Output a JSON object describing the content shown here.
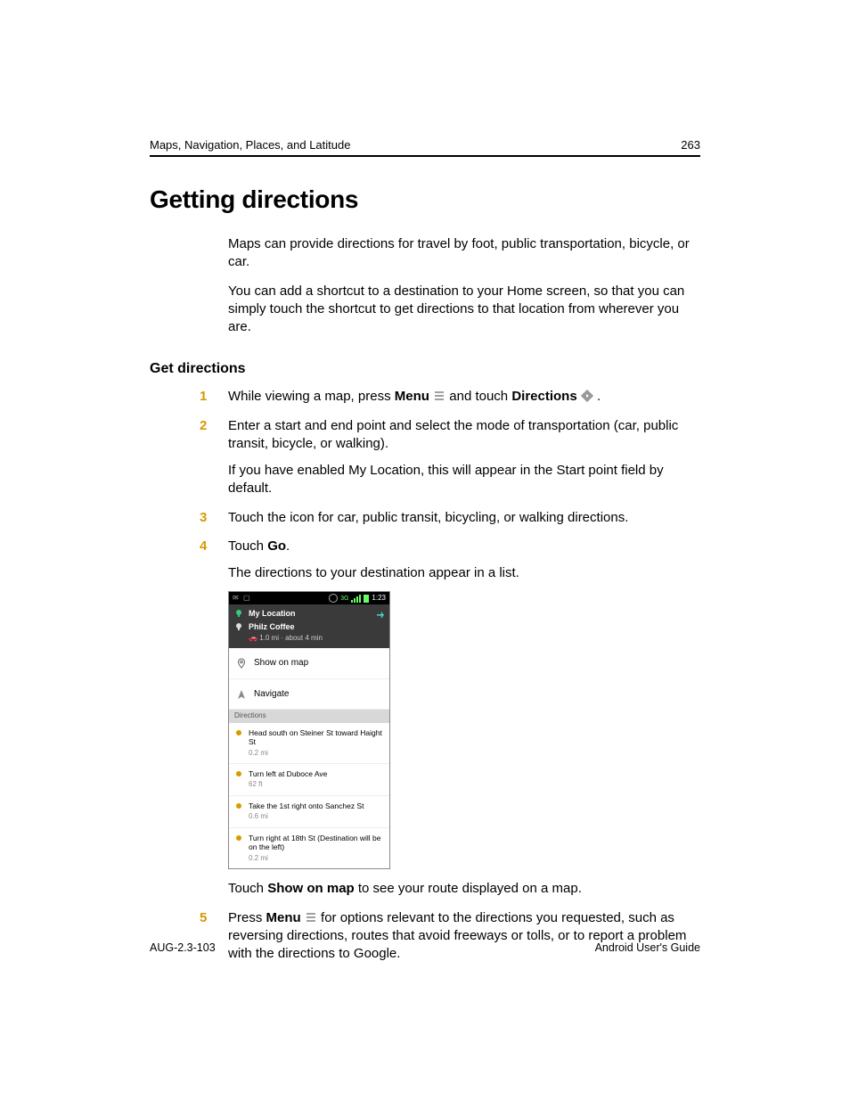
{
  "header": {
    "section": "Maps, Navigation, Places, and Latitude",
    "page": "263"
  },
  "title": "Getting directions",
  "intro": [
    "Maps can provide directions for travel by foot, public transportation, bicycle, or car.",
    "You can add a shortcut to a destination to your Home screen, so that you can simply touch the shortcut to get directions to that location from wherever you are."
  ],
  "subhead": "Get directions",
  "steps": {
    "1": {
      "a": "While viewing a map, press ",
      "menu": "Menu",
      "b": " and touch ",
      "dir": "Directions",
      "c": " ."
    },
    "2": {
      "a": "Enter a start and end point and select the mode of transportation (car, public transit, bicycle, or walking).",
      "b": "If you have enabled My Location, this will appear in the Start point field by default."
    },
    "3": "Touch the icon for car, public transit, bicycling, or walking directions.",
    "4": {
      "a": "Touch ",
      "go": "Go",
      "b": ".",
      "c": "The directions to your destination appear in a list.",
      "after_a": "Touch ",
      "after_b": "Show on map",
      "after_c": " to see your route displayed on a map."
    },
    "5": {
      "a": "Press ",
      "menu": "Menu",
      "b": " for options relevant to the directions you requested, such as reversing directions, routes that avoid freeways or tolls, or to report a problem with the directions to Google."
    }
  },
  "shot": {
    "clock": "1:23",
    "from": "My Location",
    "to": "Philz Coffee",
    "summary": "1.0 mi · about 4 min",
    "showmap": "Show on map",
    "navigate": "Navigate",
    "dirlabel": "Directions",
    "items": [
      {
        "t": "Head south on Steiner St toward Haight St",
        "d": "0.2 mi"
      },
      {
        "t": "Turn left at Duboce Ave",
        "d": "62 ft"
      },
      {
        "t": "Take the 1st right onto Sanchez St",
        "d": "0.6 mi"
      },
      {
        "t": "Turn right at 18th St (Destination will be on the left)",
        "d": "0.2 mi"
      }
    ]
  },
  "footer": {
    "left": "AUG-2.3-103",
    "right": "Android User's Guide"
  }
}
